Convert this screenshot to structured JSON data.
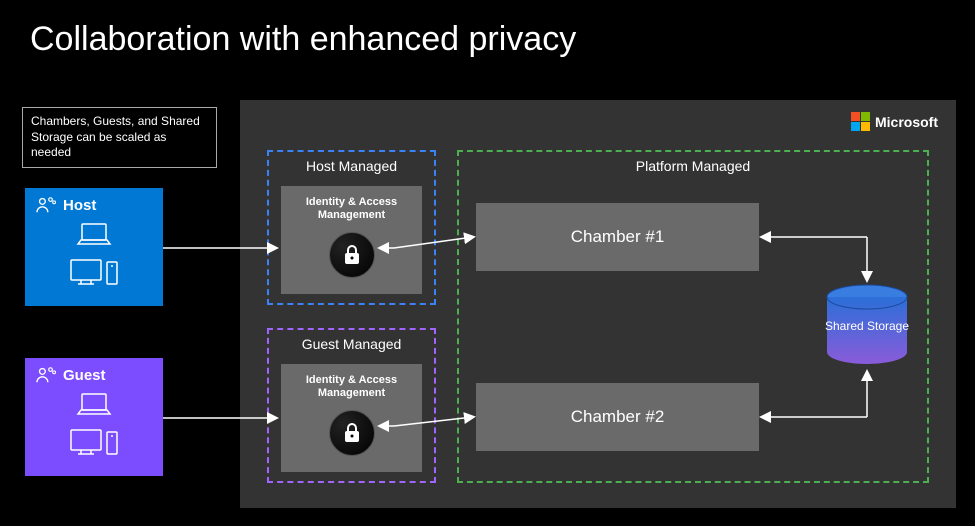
{
  "title": "Collaboration with enhanced privacy",
  "note": "Chambers, Guests, and Shared Storage can be scaled as needed",
  "brand": "Microsoft",
  "host": {
    "label": "Host"
  },
  "guest": {
    "label": "Guest"
  },
  "host_managed": {
    "label": "Host Managed",
    "iam": "Identity & Access Management"
  },
  "guest_managed": {
    "label": "Guest Managed",
    "iam": "Identity & Access Management"
  },
  "platform": {
    "label": "Platform Managed"
  },
  "chamber1": "Chamber #1",
  "chamber2": "Chamber #2",
  "storage": "Shared Storage"
}
